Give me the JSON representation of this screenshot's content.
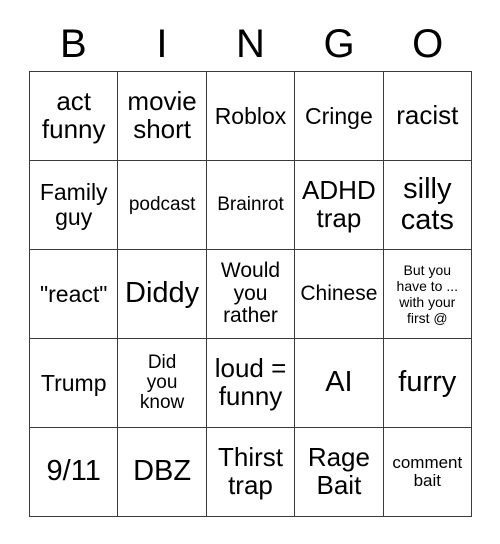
{
  "card": {
    "header_letters": [
      "B",
      "I",
      "N",
      "G",
      "O"
    ],
    "columns": 5,
    "rows": 5,
    "colors": {
      "background": "#ffffff",
      "border": "#3b3b3b",
      "text": "#000000"
    },
    "cells": [
      {
        "text": "act\nfunny",
        "size": "lg"
      },
      {
        "text": "movie\nshort",
        "size": "lg"
      },
      {
        "text": "Roblox",
        "size": "md"
      },
      {
        "text": "Cringe",
        "size": "md"
      },
      {
        "text": "racist",
        "size": "lg"
      },
      {
        "text": "Family\nguy",
        "size": "md"
      },
      {
        "text": "podcast",
        "size": "xs"
      },
      {
        "text": "Brainrot",
        "size": "xs"
      },
      {
        "text": "ADHD\ntrap",
        "size": "lg"
      },
      {
        "text": "silly\ncats",
        "size": "xl"
      },
      {
        "text": "\"react\"",
        "size": "md"
      },
      {
        "text": "Diddy",
        "size": "xl"
      },
      {
        "text": "Would\nyou\nrather",
        "size": "sm"
      },
      {
        "text": "Chinese",
        "size": "sm"
      },
      {
        "text": "But you\nhave to ...\nwith your\nfirst @",
        "size": "tiny"
      },
      {
        "text": "Trump",
        "size": "md"
      },
      {
        "text": "Did\nyou\nknow",
        "size": "xs"
      },
      {
        "text": "loud =\nfunny",
        "size": "lg"
      },
      {
        "text": "AI",
        "size": "xl"
      },
      {
        "text": "furry",
        "size": "xl"
      },
      {
        "text": "9/11",
        "size": "xl"
      },
      {
        "text": "DBZ",
        "size": "xl"
      },
      {
        "text": "Thirst\ntrap",
        "size": "lg"
      },
      {
        "text": "Rage\nBait",
        "size": "lg"
      },
      {
        "text": "comment\nbait",
        "size": "xxs"
      }
    ]
  }
}
